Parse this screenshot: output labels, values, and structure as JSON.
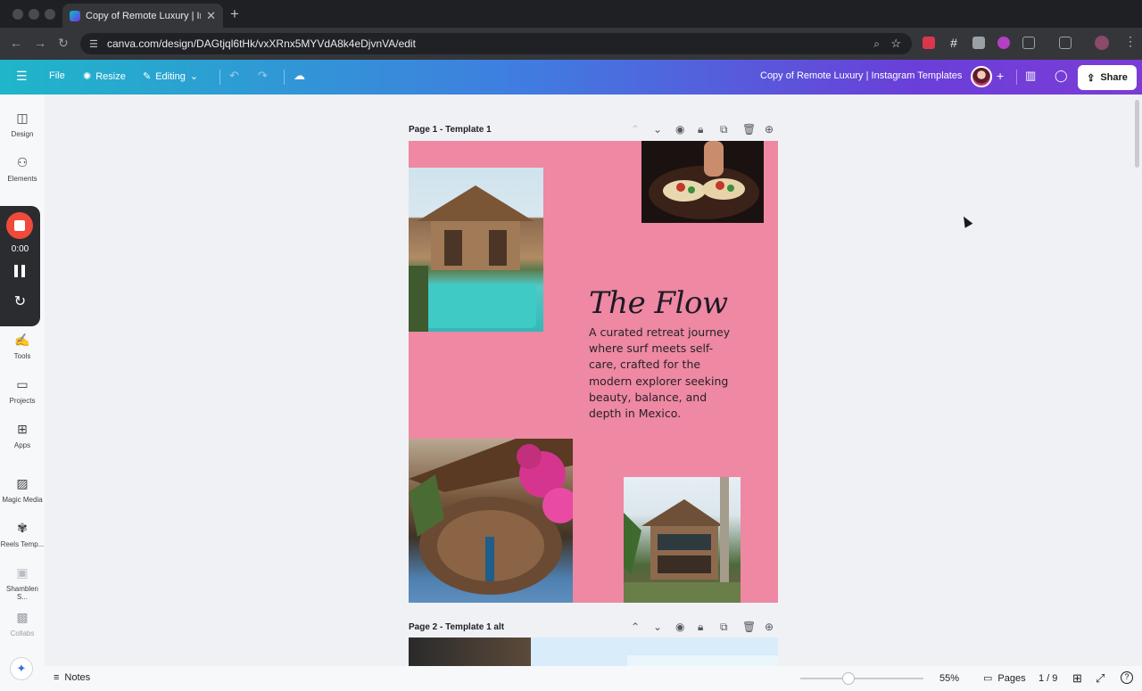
{
  "browser": {
    "tab_title": "Copy of Remote Luxury | Insta",
    "url": "canva.com/design/DAGtjql6tHk/vxXRnx5MYVdA8k4eDjvnVA/edit"
  },
  "toolbar": {
    "file": "File",
    "resize": "Resize",
    "editing": "Editing",
    "doc_title": "Copy of Remote Luxury | Instagram Templates",
    "share": "Share"
  },
  "sidebar": {
    "items": [
      {
        "label": "Design"
      },
      {
        "label": "Elements"
      },
      {
        "label": "Tools"
      },
      {
        "label": "Projects"
      },
      {
        "label": "Apps"
      },
      {
        "label": "Magic Media"
      },
      {
        "label": "Reels Temp..."
      },
      {
        "label": "Shamblen S..."
      },
      {
        "label": "Collabs"
      }
    ]
  },
  "recorder": {
    "time": "0:00"
  },
  "pages": [
    {
      "label": "Page 1 - Template 1"
    },
    {
      "label": "Page 2 - Template 1 alt"
    }
  ],
  "design": {
    "title": "The Flow",
    "body": "A curated retreat journey where surf meets self-care, crafted for the modern explorer seeking beauty, balance, and depth in Mexico.",
    "background_color": "#ee88a3"
  },
  "bottom": {
    "notes": "Notes",
    "zoom": "55%",
    "zoom_level": 0.55,
    "pages": "Pages",
    "page_count": "1 / 9"
  },
  "colors": {
    "accent_gradient_start": "#1fb6c9",
    "accent_gradient_end": "#7b3cd6",
    "recorder_stop": "#f04a3a"
  }
}
